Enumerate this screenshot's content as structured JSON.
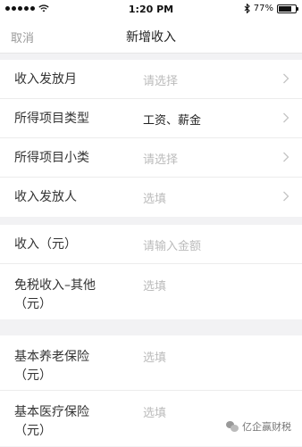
{
  "status_bar": {
    "time": "1:20 PM",
    "battery": "77%",
    "battery_level": 0.77,
    "icons": [
      "signal-dots-icon",
      "wifi-icon",
      "bluetooth-icon",
      "battery-icon"
    ]
  },
  "nav": {
    "cancel_label": "取消",
    "title": "新增收入"
  },
  "group1": {
    "rows": [
      {
        "label": "收入发放月",
        "value": "请选择",
        "filled": false,
        "chevron": true
      },
      {
        "label": "所得项目类型",
        "value": "工资、薪金",
        "filled": true,
        "chevron": true
      },
      {
        "label": "所得项目小类",
        "value": "请选择",
        "filled": false,
        "chevron": true
      },
      {
        "label": "收入发放人",
        "value": "选填",
        "filled": false,
        "chevron": true
      }
    ]
  },
  "group2": {
    "rows": [
      {
        "label": "收入（元）",
        "value": "请输入金额",
        "filled": false
      },
      {
        "label": "免税收入–其他（元）",
        "value": "选填",
        "filled": false
      }
    ]
  },
  "group3": {
    "rows": [
      {
        "label": "基本养老保险（元）",
        "value": "选填",
        "filled": false
      },
      {
        "label": "基本医疗保险（元）",
        "value": "选填",
        "filled": false
      }
    ]
  },
  "watermark": {
    "text": "亿企赢财税",
    "icon": "wechat-icon"
  },
  "colors": {
    "placeholder": "#bbbbbb",
    "background": "#f2f2f4",
    "text": "#333333"
  }
}
